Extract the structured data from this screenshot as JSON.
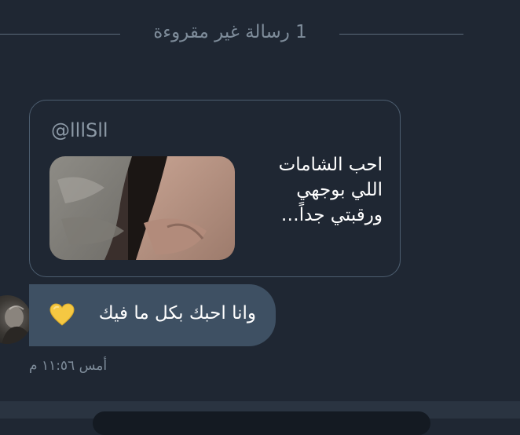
{
  "unread_divider": {
    "label": "1 رسالة غير مقروءة"
  },
  "quoted_tweet": {
    "username": "@lllSll",
    "text_lines": [
      "احب الشامات",
      "اللي بوجهي",
      "ورقبتي جداً…"
    ],
    "image_icon": "photo-thumbnail"
  },
  "message": {
    "text": "وانا احبك بكل ما فيك",
    "emoji_icon": "yellow-heart-icon",
    "emoji_color": "#f5c842"
  },
  "timestamp": "أمس ١١:٥٦ م",
  "colors": {
    "background": "#1f2733",
    "bubble": "#3e5063",
    "card_border": "#4d5e70",
    "muted_text": "#7e8c9a"
  }
}
